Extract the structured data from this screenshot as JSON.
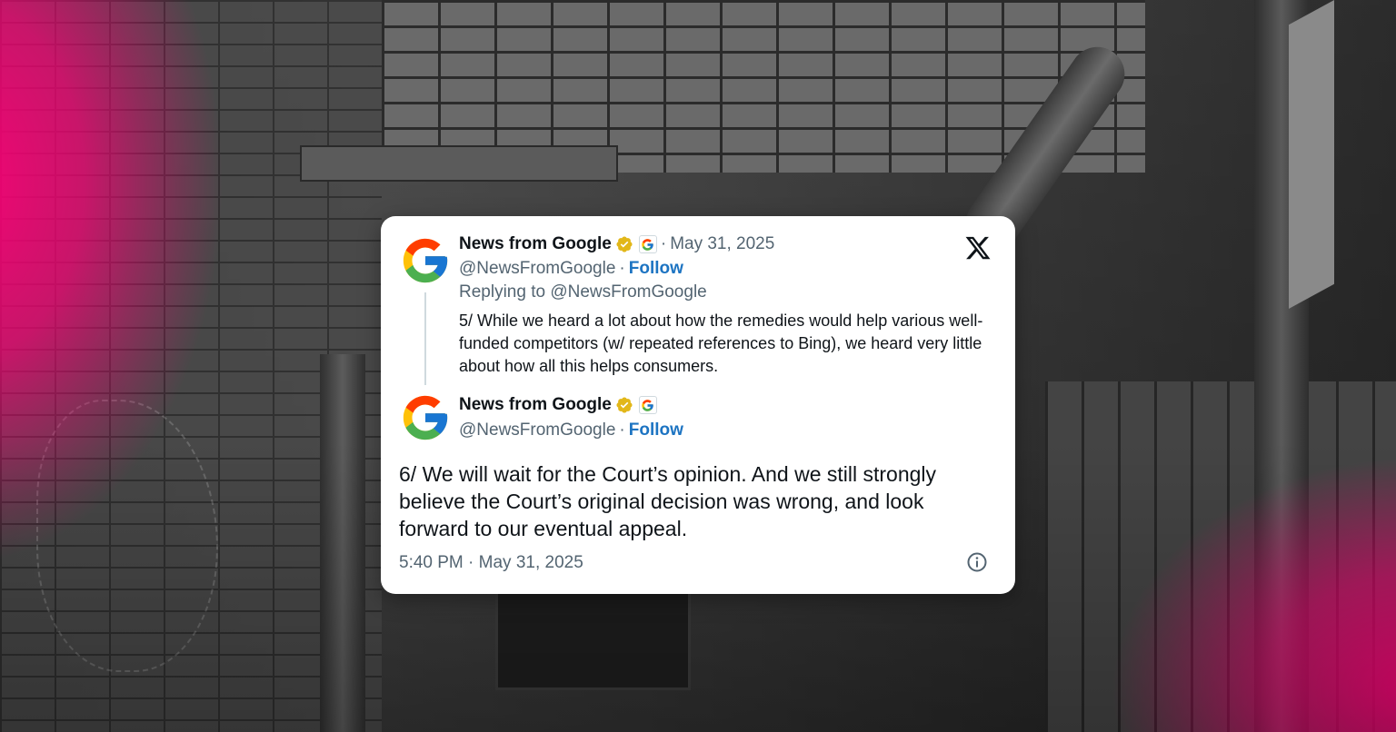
{
  "tweet": {
    "reply": {
      "author_name": "News from Google",
      "date": "May 31, 2025",
      "handle": "@NewsFromGoogle",
      "follow_label": "Follow",
      "replying_to": "Replying to @NewsFromGoogle",
      "text": "5/ While we heard a lot about how the remedies would help various well-funded competitors (w/ repeated references to Bing), we heard very little about how all this helps consumers."
    },
    "main": {
      "author_name": "News from Google",
      "handle": "@NewsFromGoogle",
      "follow_label": "Follow",
      "text": "6/ We will wait for the Court’s opinion. And we still strongly believe the Court’s original decision was wrong, and look forward to our eventual appeal.",
      "timestamp": "5:40 PM · May 31, 2025"
    },
    "separator": "·",
    "icons": {
      "platform": "x-logo-icon",
      "verified": "verified-badge-icon",
      "affiliate": "google-affiliate-icon",
      "info": "info-icon"
    }
  },
  "colors": {
    "accent_pink": "#ff0078",
    "follow_blue": "#1d74c2",
    "verified_gold": "#e2b719",
    "text_primary": "#0f1419",
    "text_secondary": "#536471"
  }
}
